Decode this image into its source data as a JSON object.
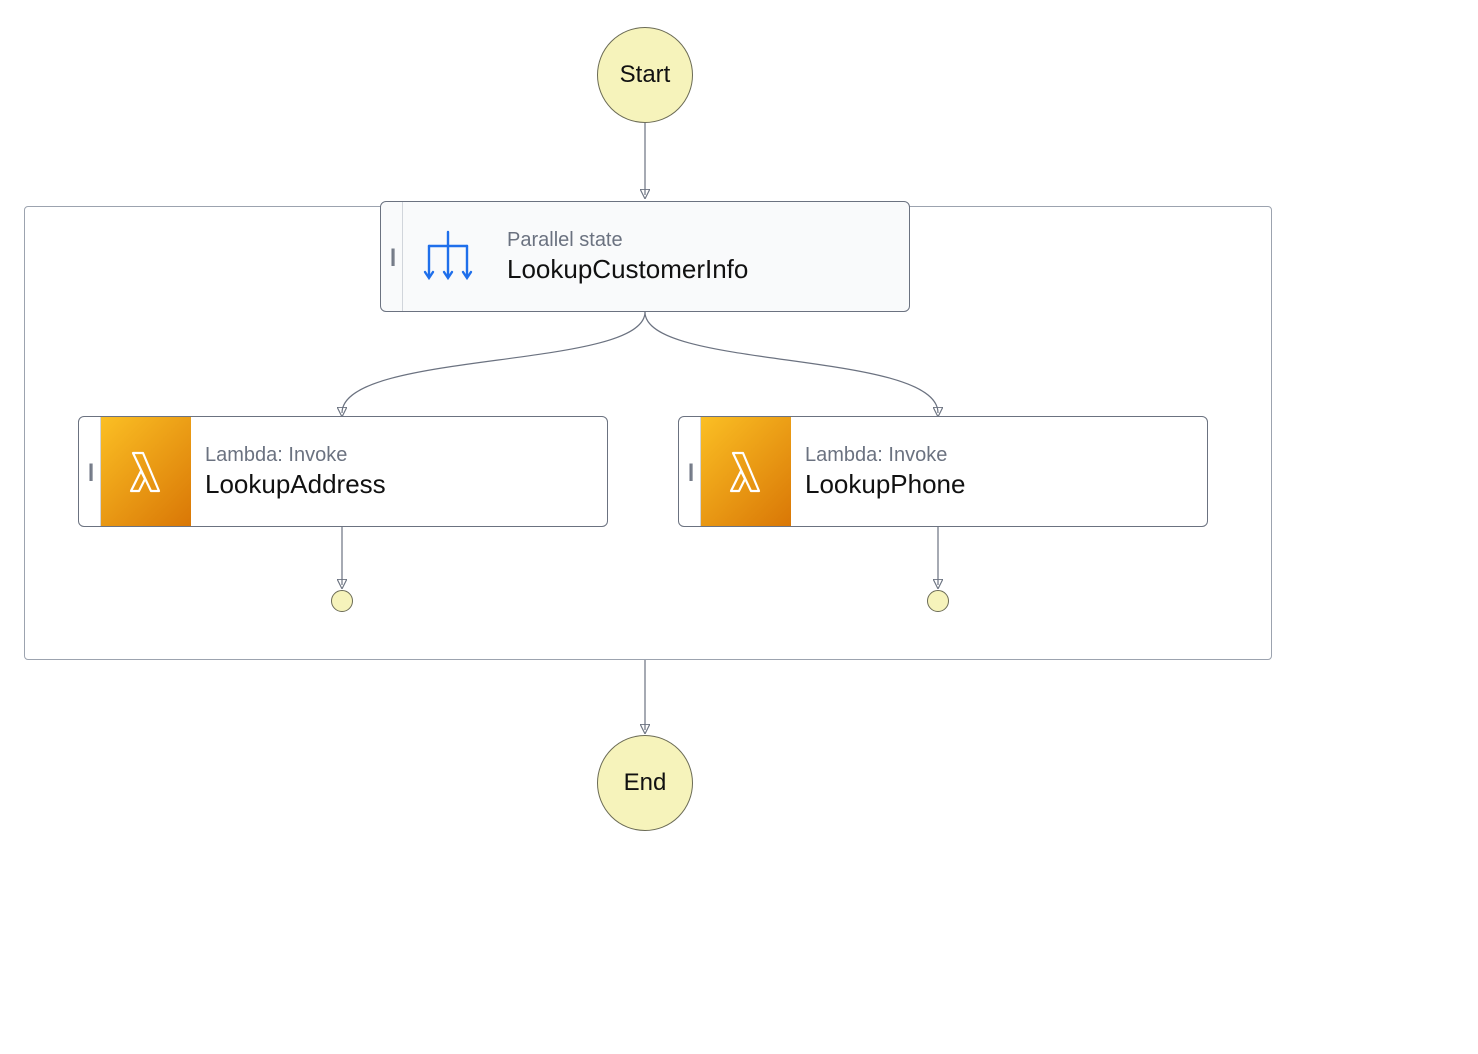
{
  "terminals": {
    "start_label": "Start",
    "end_label": "End"
  },
  "parallel": {
    "state_type": "Parallel state",
    "name": "LookupCustomerInfo"
  },
  "branches": {
    "left": {
      "category": "Lambda: Invoke",
      "name": "LookupAddress"
    },
    "right": {
      "category": "Lambda: Invoke",
      "name": "LookupPhone"
    }
  },
  "colors": {
    "lambda_icon_bg_from": "#f59e0b",
    "lambda_icon_bg_to": "#d97706",
    "parallel_icon_stroke": "#1f6feb",
    "node_border": "#6b7280",
    "term_bg": "#f6f3bb"
  }
}
